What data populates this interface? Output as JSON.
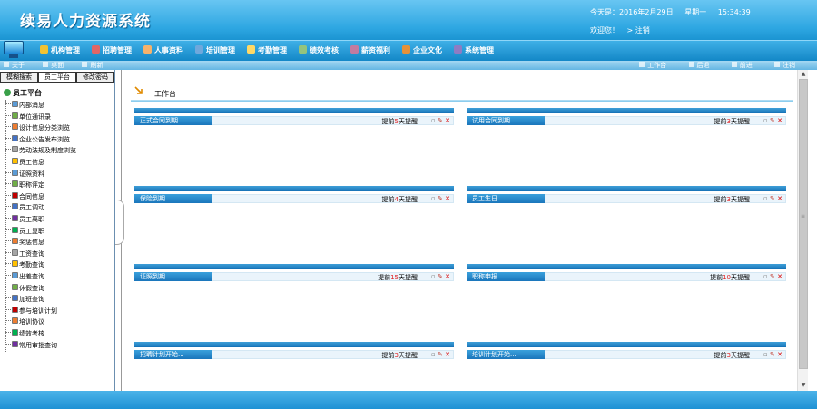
{
  "app": {
    "title": "续易人力资源系统"
  },
  "header": {
    "today": "今天是：2016年2月29日",
    "weekday": "星期一",
    "time": "15:34:39",
    "welcome": "欢迎您！",
    "logout": "> 注销"
  },
  "menu": [
    {
      "label": "机构管理",
      "color": "#f1c232"
    },
    {
      "label": "招聘管理",
      "color": "#e06666"
    },
    {
      "label": "人事资料",
      "color": "#f6b26b"
    },
    {
      "label": "培训管理",
      "color": "#6fa8dc"
    },
    {
      "label": "考勤管理",
      "color": "#ffd966"
    },
    {
      "label": "绩效考核",
      "color": "#93c47d"
    },
    {
      "label": "薪资福利",
      "color": "#c27ba0"
    },
    {
      "label": "企业文化",
      "color": "#e69138"
    },
    {
      "label": "系统管理",
      "color": "#8e7cc3"
    }
  ],
  "subbar": {
    "left": [
      "关于",
      "桌面",
      "刷新"
    ],
    "right": [
      "工作台",
      "后退",
      "前进",
      "注销"
    ]
  },
  "sidebar": {
    "tabs": [
      "模糊搜索",
      "员工平台",
      "修改密码"
    ],
    "root": "员工平台",
    "items": [
      "内部消息",
      "单位通讯录",
      "设计信息分类浏览",
      "企业公告发布浏览",
      "劳动法规及制度浏览",
      "员工信息",
      "证照资料",
      "职称评定",
      "合同信息",
      "员工调动",
      "员工离职",
      "员工复职",
      "奖惩信息",
      "工资查询",
      "考勤查询",
      "出差查询",
      "休假查询",
      "加班查询",
      "参与培训计划",
      "培训协议",
      "绩效考核",
      "常用审批查询"
    ]
  },
  "workspace": {
    "title": "工作台"
  },
  "panels": [
    {
      "title": "正式合同到期...",
      "pre": "提前",
      "num": "5",
      "post": "天提醒"
    },
    {
      "title": "试用合同到期...",
      "pre": "提前",
      "num": "3",
      "post": "天提醒"
    },
    {
      "title": "保险到期...",
      "pre": "提前",
      "num": "4",
      "post": "天提醒"
    },
    {
      "title": "员工生日...",
      "pre": "提前",
      "num": "3",
      "post": "天提醒"
    },
    {
      "title": "证照到期...",
      "pre": "提前",
      "num": "15",
      "post": "天提醒"
    },
    {
      "title": "职称申报...",
      "pre": "提前",
      "num": "10",
      "post": "天提醒"
    },
    {
      "title": "招聘计划开始...",
      "pre": "提前",
      "num": "3",
      "post": "天提醒"
    },
    {
      "title": "培训计划开始...",
      "pre": "提前",
      "num": "3",
      "post": "天提醒"
    }
  ]
}
